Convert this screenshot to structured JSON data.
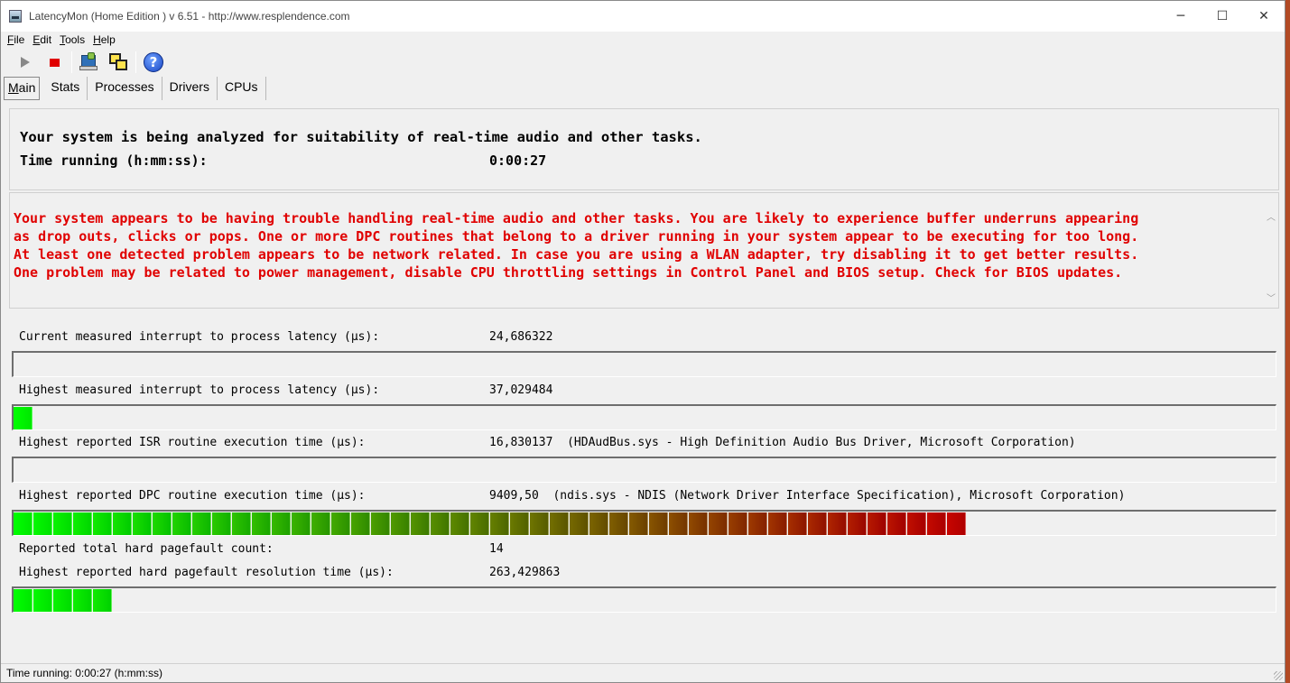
{
  "window": {
    "title": "LatencyMon  (Home Edition )  v 6.51 - http://www.resplendence.com",
    "minimize_glyph": "─",
    "maximize_glyph": "☐",
    "close_glyph": "✕"
  },
  "menu": [
    {
      "accel": "F",
      "rest": "ile"
    },
    {
      "accel": "E",
      "rest": "dit"
    },
    {
      "accel": "T",
      "rest": "ools"
    },
    {
      "accel": "H",
      "rest": "elp"
    }
  ],
  "toolbar": {
    "start_icon": "play-icon",
    "stop_icon": "stop-icon",
    "help_glyph": "?"
  },
  "tabs": [
    {
      "accel": "M",
      "rest": "ain",
      "active": true
    },
    {
      "accel": "",
      "rest": "Stats",
      "active": false
    },
    {
      "accel": "",
      "rest": "Processes",
      "active": false
    },
    {
      "accel": "",
      "rest": "Drivers",
      "active": false
    },
    {
      "accel": "",
      "rest": "CPUs",
      "active": false
    }
  ],
  "summary": {
    "analysis_text": "Your system is being analyzed for suitability of real-time audio and other tasks.",
    "time_label": "Time running (h:mm:ss):",
    "time_value": "0:00:27"
  },
  "warning": {
    "lines": [
      "Your system appears to be having trouble handling real-time audio and other tasks. You are likely to experience buffer underruns appearing",
      "as drop outs, clicks or pops. One or more DPC routines that belong to a driver running in your system appear to be executing for too long.",
      "At least one detected problem appears to be network related. In case you are using a WLAN adapter, try disabling it to get better results.",
      "One problem may be related to power management, disable CPU throttling settings in Control Panel and BIOS setup. Check for BIOS updates."
    ],
    "color": "#e00000"
  },
  "metrics": {
    "current_latency": {
      "label": "Current measured interrupt to process latency (µs):",
      "value": "24,686322",
      "bar_fraction": 0.0
    },
    "highest_latency": {
      "label": "Highest measured interrupt to process latency (µs):",
      "value": "37,029484",
      "bar_segments": 1
    },
    "isr": {
      "label": "Highest reported ISR routine execution time (µs):",
      "value": "16,830137  (HDAudBus.sys - High Definition Audio Bus Driver, Microsoft Corporation)",
      "bar_segments": 0
    },
    "dpc": {
      "label": "Highest reported DPC routine execution time (µs):",
      "value": "9409,50  (ndis.sys - NDIS (Network Driver Interface Specification), Microsoft Corporation)",
      "bar_segments": 48
    },
    "pagefault_count": {
      "label": "Reported total hard pagefault count:",
      "value": "14"
    },
    "pagefault_time": {
      "label": "Highest reported hard pagefault resolution time (µs):",
      "value": "263,429863",
      "bar_segments": 5
    }
  },
  "bar_colors": {
    "start": "#00ff00",
    "end": "#cc0000"
  },
  "statusbar": {
    "text": "Time running: 0:00:27  (h:mm:ss)"
  }
}
